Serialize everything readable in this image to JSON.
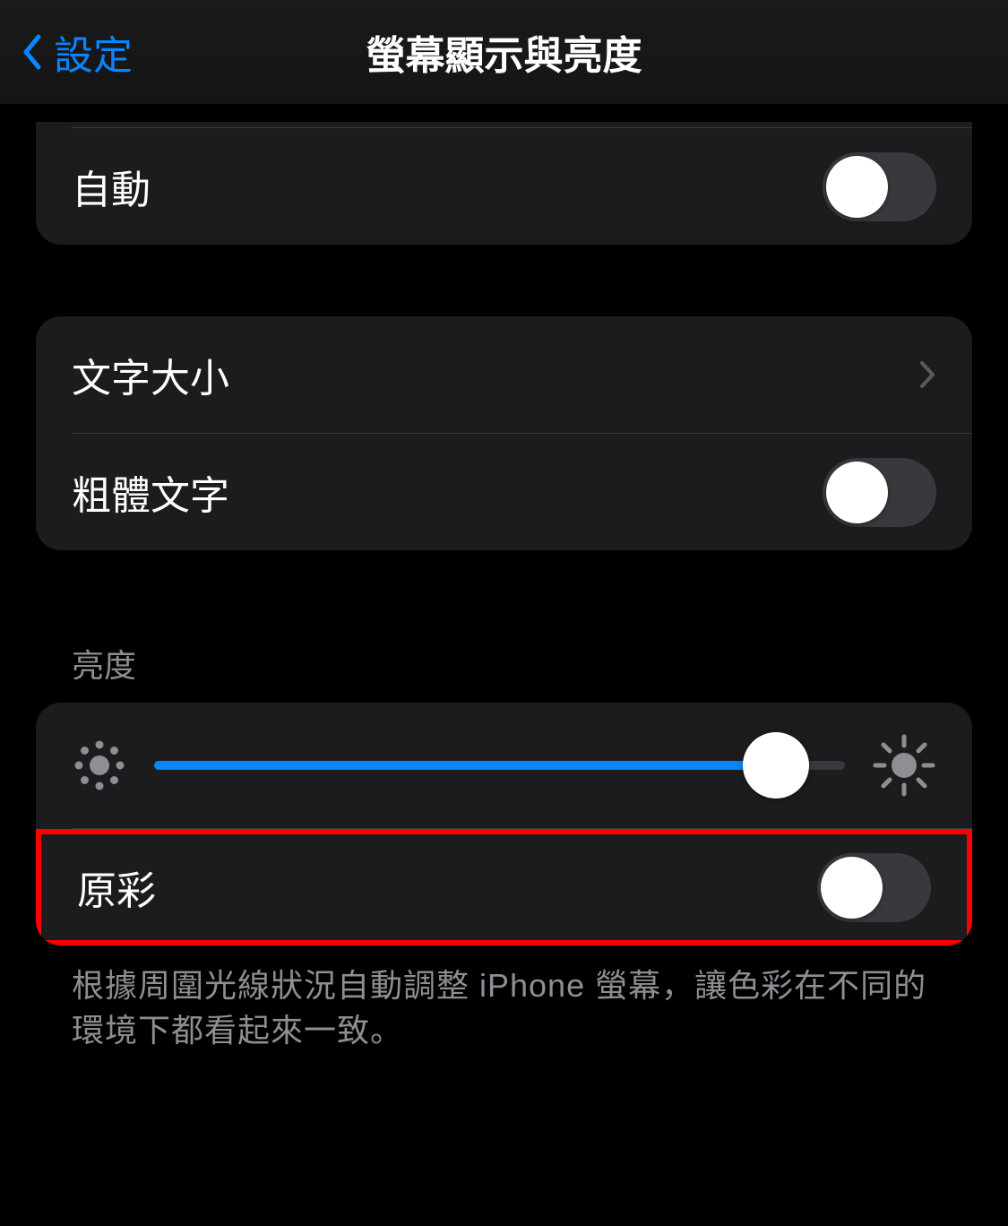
{
  "nav": {
    "back_label": "設定",
    "title": "螢幕顯示與亮度"
  },
  "group1": {
    "auto_label": "自動",
    "auto_enabled": false
  },
  "group2": {
    "text_size_label": "文字大小",
    "bold_text_label": "粗體文字",
    "bold_text_enabled": false
  },
  "brightness": {
    "header": "亮度",
    "slider_value": 90,
    "true_tone_label": "原彩",
    "true_tone_enabled": false
  },
  "footer": {
    "text": "根據周圍光線狀況自動調整 iPhone 螢幕，讓色彩在不同的環境下都看起來一致。"
  }
}
